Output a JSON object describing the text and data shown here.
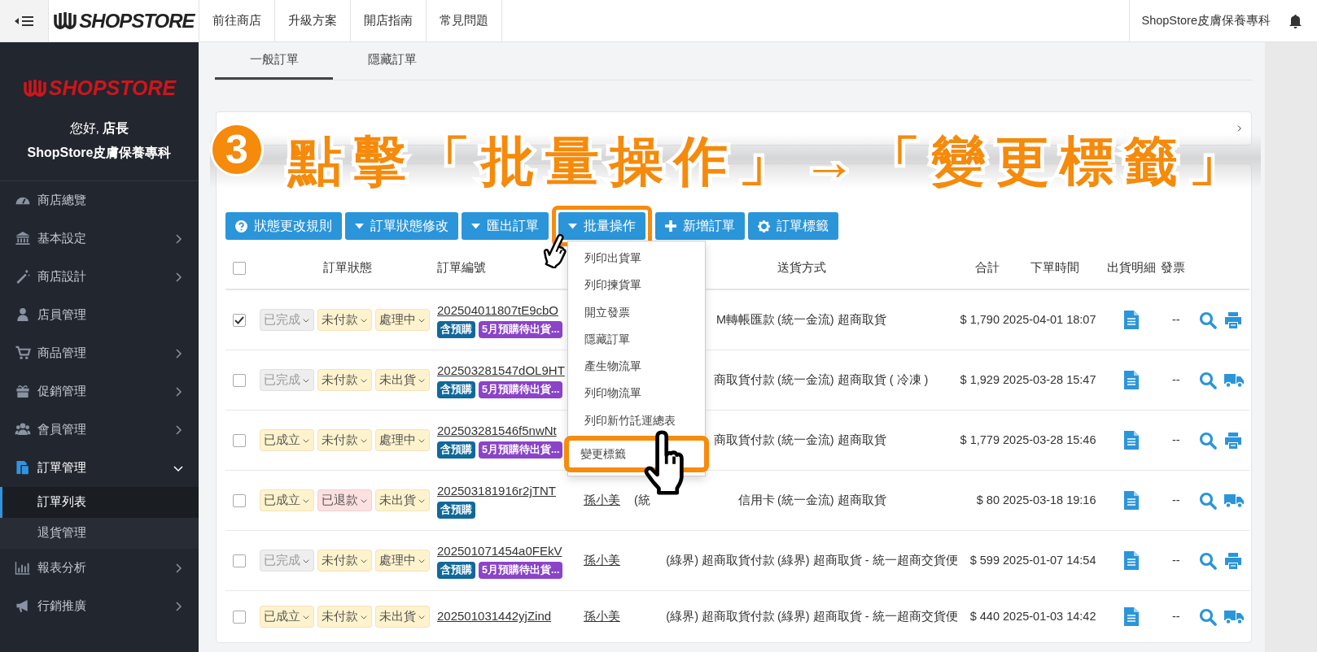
{
  "topbar": {
    "logo": "SHOPSTORE",
    "links": [
      "前往商店",
      "升級方案",
      "開店指南",
      "常見問題"
    ],
    "store": "ShopStore皮膚保養專科"
  },
  "sidebar": {
    "logo": "SHOPSTORE",
    "greeting": "您好, **店長**",
    "store": "ShopStore皮膚保養專科",
    "items": [
      {
        "label": "商店總覽",
        "selected": false
      },
      {
        "label": "基本設定",
        "selected": false,
        "expanded": false
      },
      {
        "label": "商店設計",
        "selected": false,
        "expanded": false
      },
      {
        "label": "店員管理",
        "selected": false
      },
      {
        "label": "商品管理",
        "selected": false,
        "expanded": false
      },
      {
        "label": "促銷管理",
        "selected": false,
        "expanded": false
      },
      {
        "label": "會員管理",
        "selected": false,
        "expanded": false
      },
      {
        "label": "訂單管理",
        "selected": true,
        "expanded": true,
        "children": [
          {
            "label": "訂單列表",
            "selected": true
          },
          {
            "label": "退貨管理",
            "selected": false
          }
        ]
      },
      {
        "label": "報表分析",
        "selected": false,
        "expanded": false
      },
      {
        "label": "行銷推廣",
        "selected": false,
        "expanded": false
      }
    ]
  },
  "tabs": [
    {
      "label": "一般訂單",
      "selected": true
    },
    {
      "label": "隱藏訂單",
      "selected": false
    }
  ],
  "annotation": {
    "step": "3",
    "text": "點擊「批量操作」→「變更標籤」"
  },
  "toolbar": [
    {
      "label": "狀態更改規則",
      "highlighted": false
    },
    {
      "label": "訂單狀態修改",
      "highlighted": false
    },
    {
      "label": "匯出訂單",
      "highlighted": false
    },
    {
      "label": "批量操作",
      "highlighted": true
    },
    {
      "label": "新增訂單",
      "highlighted": false
    },
    {
      "label": "訂單標籤",
      "highlighted": false
    }
  ],
  "menu": {
    "items": [
      {
        "label": "列印出貨單",
        "highlighted": false
      },
      {
        "label": "列印揀貨單",
        "highlighted": false
      },
      {
        "label": "開立發票",
        "highlighted": false
      },
      {
        "label": "隱藏訂單",
        "highlighted": false
      },
      {
        "label": "產生物流單",
        "highlighted": false
      },
      {
        "label": "列印物流單",
        "highlighted": false
      },
      {
        "label": "列印新竹託運總表",
        "highlighted": false
      },
      {
        "label": "變更標籤",
        "highlighted": true
      }
    ]
  },
  "table": {
    "select_all_checked": false,
    "headers": {
      "status": "訂單狀態",
      "order_no": "訂單編號",
      "shipping": "送貨方式",
      "total": "合計",
      "time": "下單時間",
      "detail": "出貨明細",
      "invoice": "發票"
    },
    "rows": [
      {
        "checked": true,
        "statuses": [
          {
            "label": "已完成",
            "color": "#eeeeee"
          },
          {
            "label": "未付款",
            "color": "#fff3cd"
          },
          {
            "label": "處理中",
            "color": "#fff3cd"
          }
        ],
        "order_no": "202504011807tE9cbO",
        "tags": [
          {
            "label": "含預購",
            "color": "#11689b"
          },
          {
            "label": "5月預購待出貨...",
            "color": "#8a44c8"
          }
        ],
        "payment": [
          "M轉帳匯款"
        ],
        "shipping": "(統一金流) 超商取貨",
        "total": "$ 1,790",
        "time": "2025-04-01 18:07",
        "invoice": "--"
      },
      {
        "checked": false,
        "statuses": [
          {
            "label": "已完成",
            "color": "#eeeeee"
          },
          {
            "label": "未付款",
            "color": "#fff3cd"
          },
          {
            "label": "未出貨",
            "color": "#fff3cd"
          }
        ],
        "order_no": "202503281547dOL9HT",
        "tags": [
          {
            "label": "含預購",
            "color": "#11689b"
          },
          {
            "label": "5月預購待出貨...",
            "color": "#8a44c8"
          }
        ],
        "payment": [
          "商取貨付款"
        ],
        "shipping": "(統一金流) 超商取貨 ( 冷凍 )",
        "total": "$ 1,929",
        "time": "2025-03-28 15:47",
        "invoice": "--"
      },
      {
        "checked": false,
        "statuses": [
          {
            "label": "已成立",
            "color": "#fff3cd"
          },
          {
            "label": "未付款",
            "color": "#fff3cd"
          },
          {
            "label": "處理中",
            "color": "#fff3cd"
          }
        ],
        "order_no": "202503281546f5nwNt",
        "tags": [
          {
            "label": "含預購",
            "color": "#11689b"
          },
          {
            "label": "5月預購待出貨...",
            "color": "#8a44c8"
          }
        ],
        "payment": [
          "商取貨付款"
        ],
        "shipping": "(統一金流) 超商取貨",
        "total": "$ 1,779",
        "time": "2025-03-28 15:46",
        "invoice": "--"
      },
      {
        "checked": false,
        "statuses": [
          {
            "label": "已成立",
            "color": "#fff3cd"
          },
          {
            "label": "已退款",
            "color": "#fde0e0"
          },
          {
            "label": "未出貨",
            "color": "#fff3cd"
          }
        ],
        "order_no": "202503181916r2jTNT",
        "tags": [
          {
            "label": "含預購",
            "color": "#11689b"
          }
        ],
        "buyer": "孫小美",
        "payment": [
          "(統",
          "信用卡"
        ],
        "shipping": "(統一金流) 超商取貨",
        "total": "$ 80",
        "time": "2025-03-18 19:16",
        "invoice": "--"
      },
      {
        "checked": false,
        "statuses": [
          {
            "label": "已完成",
            "color": "#eeeeee"
          },
          {
            "label": "未付款",
            "color": "#fff3cd"
          },
          {
            "label": "處理中",
            "color": "#fff3cd"
          }
        ],
        "order_no": "202501071454a0FEkV",
        "tags": [
          {
            "label": "含預購",
            "color": "#11689b"
          },
          {
            "label": "5月預購待出貨...",
            "color": "#8a44c8"
          }
        ],
        "buyer": "孫小美",
        "payment": [
          "(綠界) 超商取貨付款"
        ],
        "shipping": "(綠界) 超商取貨 - 統一超商交貨便",
        "total": "$ 599",
        "time": "2025-01-07 14:54",
        "invoice": "--"
      },
      {
        "checked": false,
        "statuses": [
          {
            "label": "已成立",
            "color": "#fff3cd"
          },
          {
            "label": "未付款",
            "color": "#fff3cd"
          },
          {
            "label": "未出貨",
            "color": "#fff3cd"
          }
        ],
        "order_no": "202501031442yjZind",
        "tags": [],
        "buyer": "孫小美",
        "payment": [
          "(綠界) 超商取貨付款"
        ],
        "shipping": "(綠界) 超商取貨 - 統一超商交貨便",
        "total": "$ 440",
        "time": "2025-01-03 14:42",
        "invoice": "--"
      }
    ]
  }
}
